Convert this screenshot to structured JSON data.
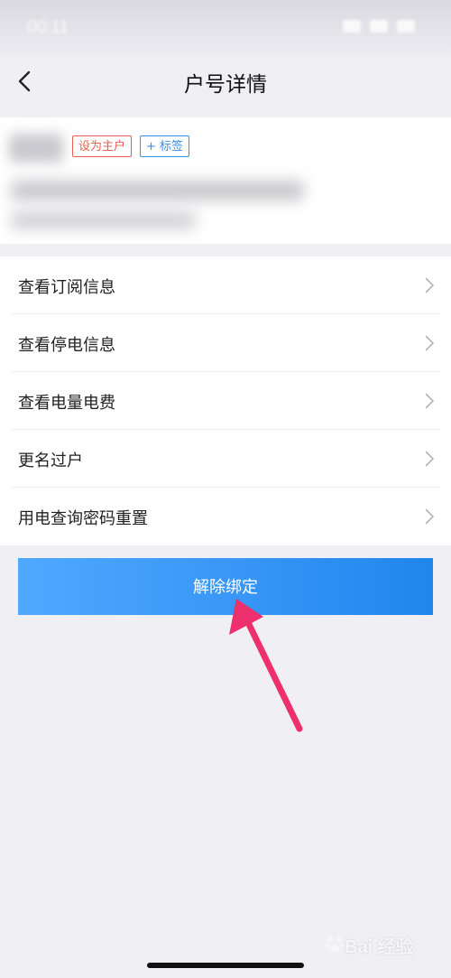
{
  "status_bar": {
    "time": "00:11"
  },
  "header": {
    "title": "户号详情"
  },
  "account": {
    "tag_primary": "设为主户",
    "tag_add": "+ 标签"
  },
  "menu": {
    "items": [
      {
        "label": "查看订阅信息"
      },
      {
        "label": "查看停电信息"
      },
      {
        "label": "查看电量电费"
      },
      {
        "label": "更名过户"
      },
      {
        "label": "用电查询密码重置"
      }
    ]
  },
  "actions": {
    "unbind_label": "解除绑定"
  },
  "watermark": {
    "text": "Bai 经验"
  },
  "colors": {
    "primary_button": "#3a97f7",
    "tag_primary": "#e8614f",
    "tag_add": "#3a8ee6",
    "arrow": "#ee2f6e"
  }
}
